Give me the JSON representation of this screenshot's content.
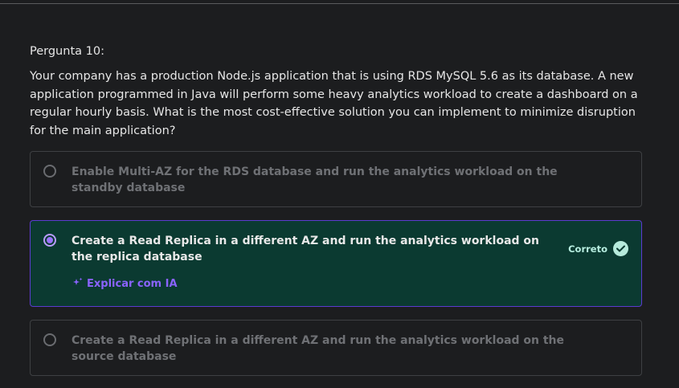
{
  "question": {
    "label": "Pergunta 10:",
    "text": "Your company has a production Node.js application that is using RDS MySQL 5.6 as its database. A new application programmed in Java will perform some heavy analytics workload to create a dashboard on a regular hourly basis. What is the most cost-effective solution you can implement to minimize disruption for the main application?"
  },
  "options": [
    {
      "text": "Enable Multi-AZ for the RDS database and run the analytics workload on the standby database",
      "selected": false
    },
    {
      "text": "Create a Read Replica in a different AZ and run the analytics workload on the replica database",
      "selected": true,
      "status_label": "Correto",
      "explain_label": "Explicar com IA"
    },
    {
      "text": "Create a Read Replica in a different AZ and run the analytics workload on the source database",
      "selected": false
    }
  ],
  "icons": {
    "correct": "check-circle-icon",
    "explain": "sparkle-icon"
  },
  "colors": {
    "correct_bg": "#0b3a31",
    "selected_border": "#5c3bd0",
    "accent_purple": "#8a63ff",
    "correct_check": "#b6eadb"
  }
}
